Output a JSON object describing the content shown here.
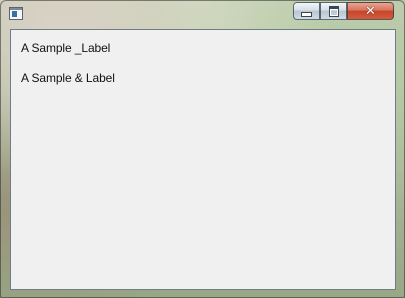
{
  "window": {
    "title": "",
    "controls": {
      "minimize_icon": "minimize-icon",
      "maximize_icon": "maximize-icon",
      "close_icon": "close-icon",
      "close_glyph": "✕"
    },
    "accent_close_color": "#c6452a"
  },
  "content": {
    "labels": [
      {
        "text": "A Sample _Label"
      },
      {
        "text": "A Sample & Label"
      }
    ],
    "background_color": "#f0f0f0"
  }
}
